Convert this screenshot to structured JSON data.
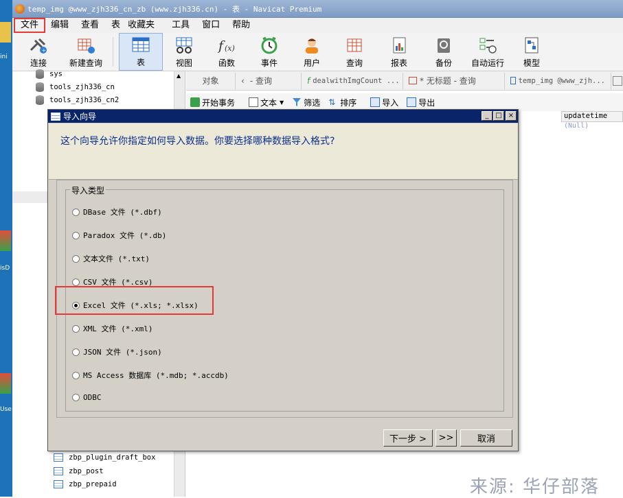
{
  "window": {
    "title": "temp_img @www_zjh336_cn_zb (www.zjh336.cn) - 表 - Navicat Premium"
  },
  "desktop": {
    "labels": [
      "ini",
      "isD",
      "Use"
    ]
  },
  "menu": [
    "文件",
    "编辑",
    "查看",
    "表",
    "收藏夹",
    "工具",
    "窗口",
    "帮助"
  ],
  "toolbar": [
    {
      "label": "连接",
      "icon": "plug-icon"
    },
    {
      "label": "新建查询",
      "icon": "new-query-icon"
    },
    {
      "label": "表",
      "icon": "table-icon",
      "active": true
    },
    {
      "label": "视图",
      "icon": "view-icon"
    },
    {
      "label": "函数",
      "icon": "function-icon"
    },
    {
      "label": "事件",
      "icon": "clock-icon"
    },
    {
      "label": "用户",
      "icon": "user-icon"
    },
    {
      "label": "查询",
      "icon": "query-icon"
    },
    {
      "label": "报表",
      "icon": "report-icon"
    },
    {
      "label": "备份",
      "icon": "backup-icon"
    },
    {
      "label": "自动运行",
      "icon": "schedule-icon"
    },
    {
      "label": "模型",
      "icon": "model-icon"
    }
  ],
  "tree": {
    "items": [
      "sys",
      "tools_zjh336_cn",
      "tools_zjh336_cn2"
    ],
    "bottom_items": [
      "zbp_plugin_draft_box",
      "zbp_post",
      "zbp_prepaid"
    ]
  },
  "object_tabs": [
    "对象",
    "- 查询",
    "dealwithImgCount ...",
    "* 无标题 - 查询",
    "temp_img @www_zjh..."
  ],
  "subtoolbar": [
    "开始事务",
    "文本",
    "筛选",
    "排序",
    "导入",
    "导出"
  ],
  "grid": {
    "column": "updatetime",
    "cell": "(Null)"
  },
  "dialog": {
    "title": "导入向导",
    "prompt": "这个向导允许你指定如何导入数据。你要选择哪种数据导入格式?",
    "group_label": "导入类型",
    "options": [
      "DBase 文件 (*.dbf)",
      "Paradox 文件 (*.db)",
      "文本文件 (*.txt)",
      "CSV 文件 (*.csv)",
      "Excel 文件 (*.xls; *.xlsx)",
      "XML 文件 (*.xml)",
      "JSON 文件 (*.json)",
      "MS Access 数据库 (*.mdb; *.accdb)",
      "ODBC"
    ],
    "selected_index": 4,
    "next_label": "下一步 >",
    "skip_label": ">>",
    "cancel_label": "取消",
    "win_buttons": [
      "_",
      "□",
      "×"
    ]
  },
  "watermark": "来源: 华仔部落"
}
